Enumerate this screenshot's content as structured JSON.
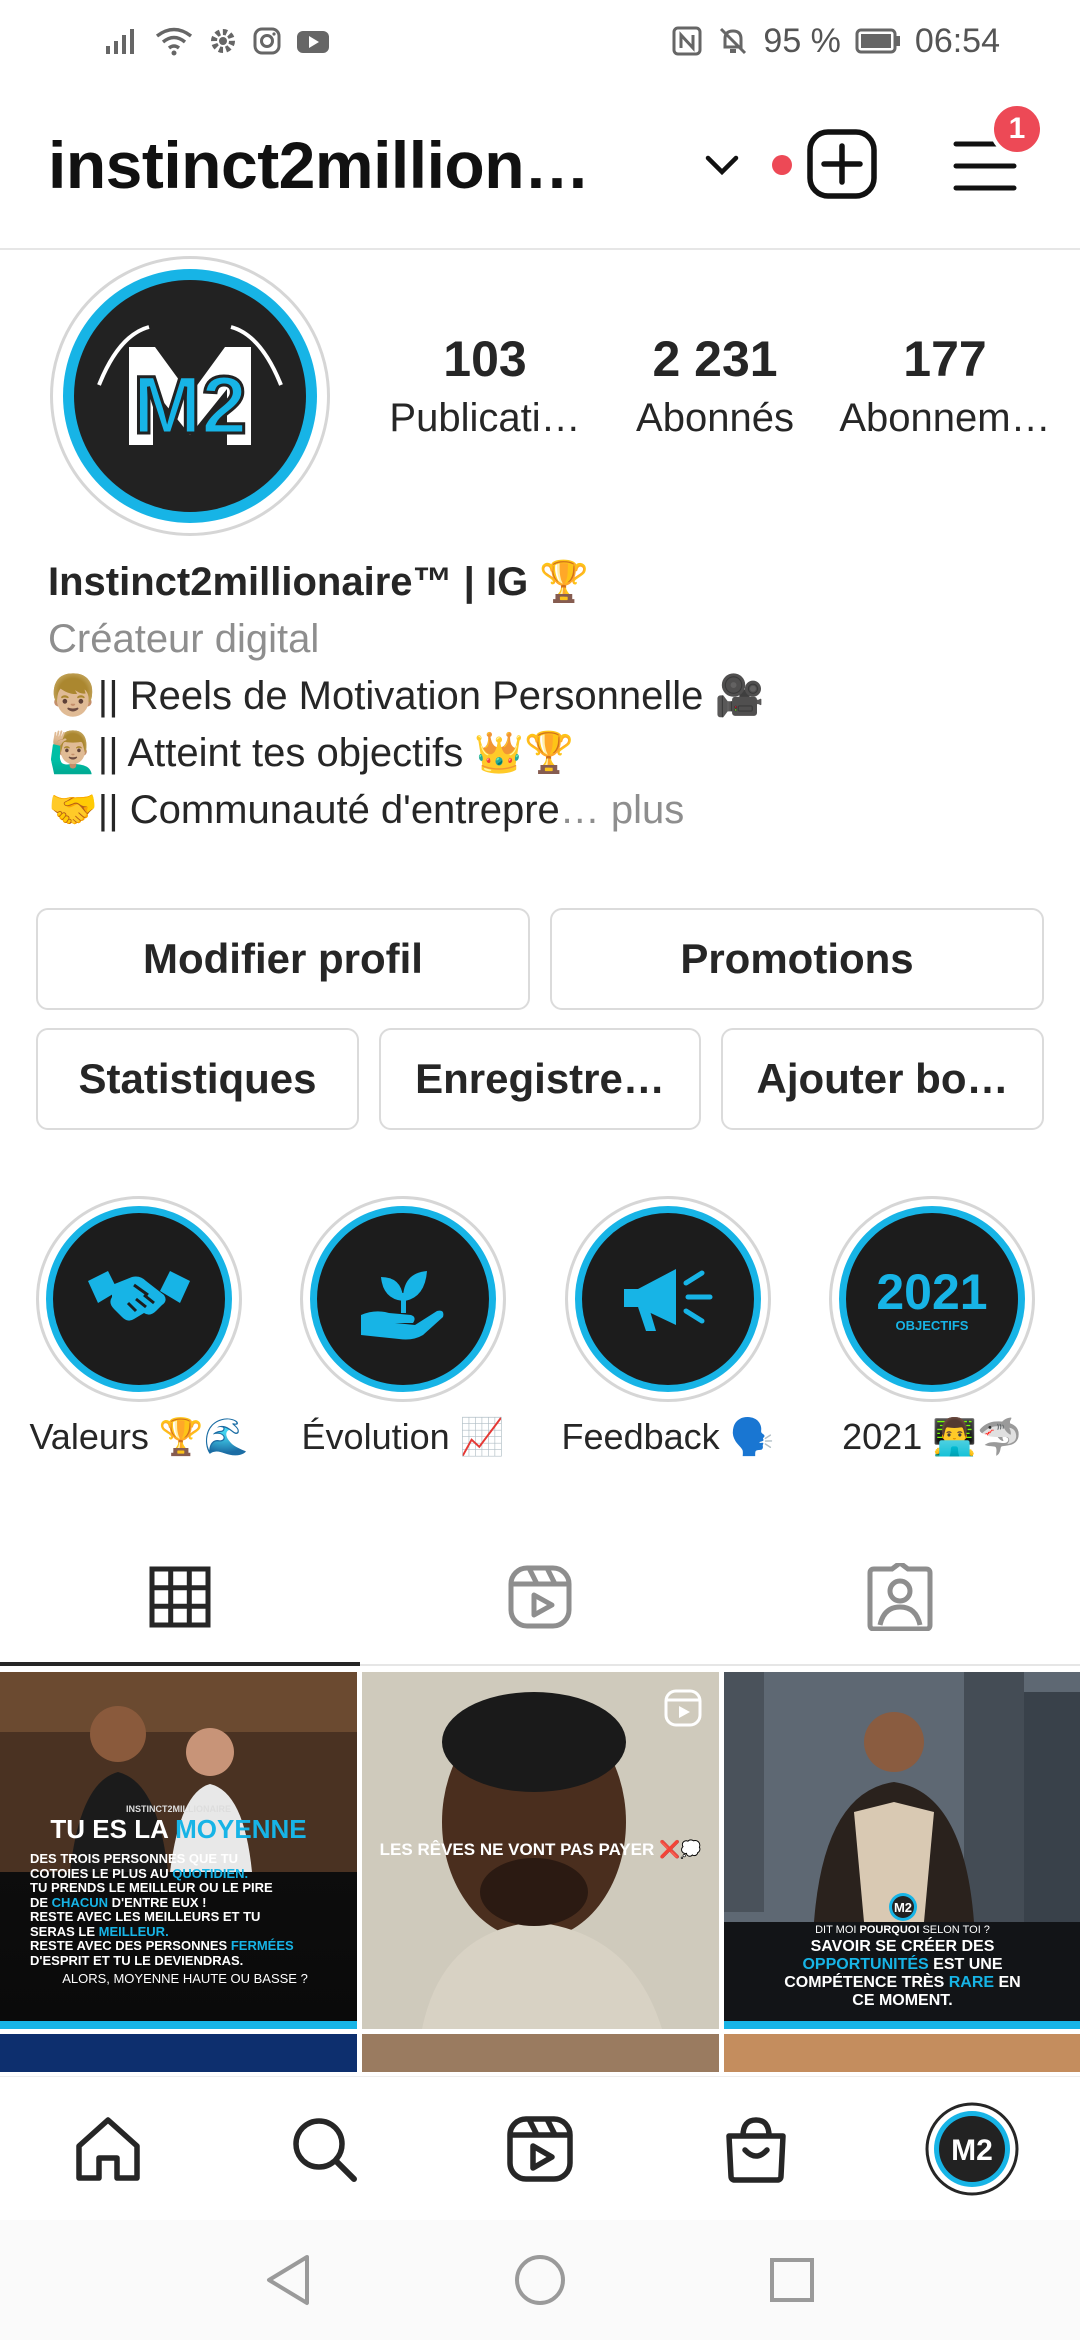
{
  "status_bar": {
    "battery": "95 %",
    "time": "06:54",
    "left_icons": [
      "signal-icon",
      "wifi-icon",
      "settings-icon",
      "instagram-icon",
      "youtube-icon"
    ],
    "right_icons": [
      "nfc-icon",
      "mute-icon",
      "battery-icon"
    ]
  },
  "header": {
    "username": "instinct2million…",
    "notification_count": "1",
    "accent_red": "#ed4956"
  },
  "profile": {
    "avatar_text": "M2",
    "stats": [
      {
        "value": "103",
        "label": "Publicati…"
      },
      {
        "value": "2 231",
        "label": "Abonnés"
      },
      {
        "value": "177",
        "label": "Abonnem…"
      }
    ]
  },
  "bio": {
    "name": "Instinct2millionaire™ | IG 🏆",
    "category": "Créateur digital",
    "line1": "👦🏼|| Reels de Motivation Personnelle 🎥",
    "line2": "🙋🏼‍♂️|| Atteint tes objectifs 👑🏆",
    "line3": "🤝|| Communauté d'entrepre",
    "more": "… plus"
  },
  "buttons": {
    "edit_profile": "Modifier profil",
    "promotions": "Promotions",
    "insights": "Statistiques",
    "saved": "Enregistre…",
    "add_button": "Ajouter bo…"
  },
  "highlights": [
    {
      "label": "Valeurs 🏆🌊",
      "icon": "handshake-icon"
    },
    {
      "label": "Évolution 📈",
      "icon": "plant-hand-icon"
    },
    {
      "label": "Feedback 🗣️",
      "icon": "megaphone-icon"
    },
    {
      "label": "2021 👨‍💻🦈",
      "icon": "year-2021-icon",
      "big_text": "2021",
      "small_text": "OBJECTIFS"
    }
  ],
  "highlight_accent": "#17b4e6",
  "tabs": [
    {
      "name": "grid-icon",
      "active": true
    },
    {
      "name": "reels-icon",
      "active": false
    },
    {
      "name": "tagged-icon",
      "active": false
    }
  ],
  "posts": {
    "p1": {
      "small": "INSTINCT2MILLIONAIRE",
      "headline_white": "TU ES LA ",
      "headline_blue": "MOYENNE",
      "l1": "DES TROIS PERSONNES QUE TU",
      "l2a": "COTOIES LE PLUS AU ",
      "l2b": "QUOTIDIEN.",
      "l3": "TU PRENDS LE MEILLEUR OU LE PIRE",
      "l4a": "DE ",
      "l4b": "CHACUN",
      "l4c": " D'ENTRE EUX !",
      "l5": "RESTE AVEC LES MEILLEURS ET TU",
      "l6a": "SERAS LE ",
      "l6b": "MEILLEUR.",
      "l7a": "RESTE AVEC DES PERSONNES ",
      "l7b": "FERMÉES",
      "l8": "D'ESPRIT ET TU LE DEVIENDRAS.",
      "l9": "ALORS, MOYENNE HAUTE OU BASSE ?"
    },
    "p2": {
      "caption": "LES  RÊVES NE VONT PAS PAYER ❌💭"
    },
    "p3": {
      "l1a": "DIT MOI ",
      "l1b": "POURQUOI",
      "l1c": " SELON TOI ?",
      "l2": "SAVOIR SE CRÉER DES",
      "l3a": "OPPORTUNITÉS",
      "l3b": " EST UNE",
      "l4a": "COMPÉTENCE TRÈS ",
      "l4b": "RARE",
      "l4c": " EN",
      "l5": "CE MOMENT."
    }
  },
  "bottom_nav": [
    "home-icon",
    "search-icon",
    "reels-icon",
    "shop-icon",
    "profile-avatar"
  ]
}
